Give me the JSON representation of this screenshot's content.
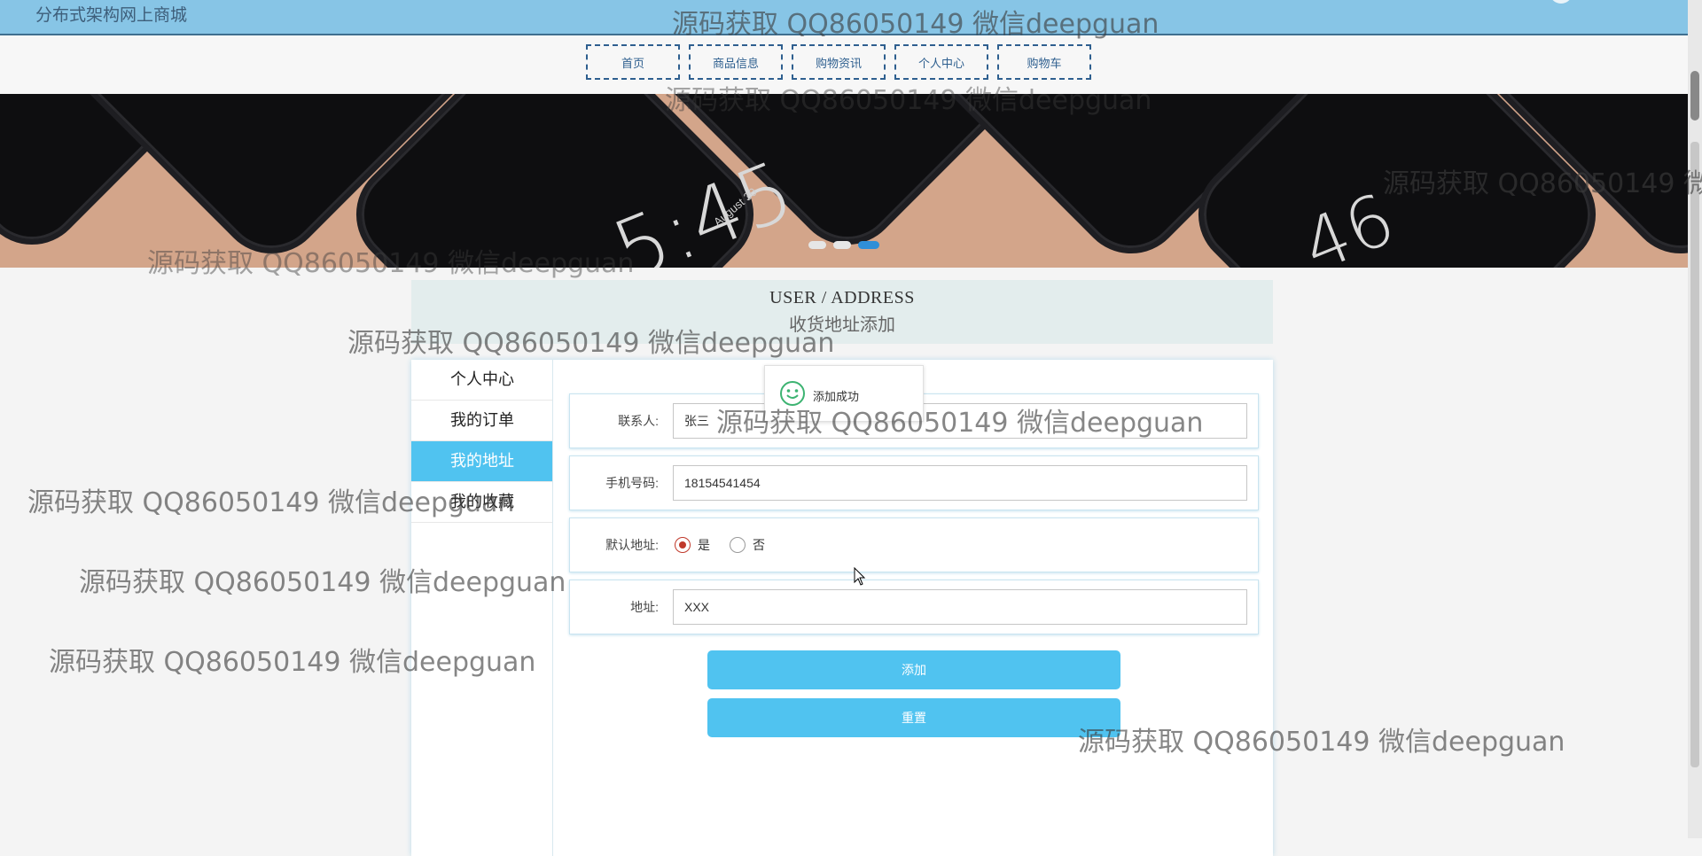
{
  "site": {
    "title": "分布式架构网上商城"
  },
  "nav": [
    {
      "label": "首页"
    },
    {
      "label": "商品信息"
    },
    {
      "label": "购物资讯"
    },
    {
      "label": "个人中心"
    },
    {
      "label": "购物车"
    }
  ],
  "banner": {
    "slide_count": 3,
    "active_slide": 3,
    "times": [
      "5:45",
      "46"
    ],
    "date_text": "August 30"
  },
  "page": {
    "title_en": "USER / ADDRESS",
    "title_cn": "收货地址添加"
  },
  "sidebar": {
    "items": [
      {
        "label": "个人中心",
        "active": false
      },
      {
        "label": "我的订单",
        "active": false
      },
      {
        "label": "我的地址",
        "active": true
      },
      {
        "label": "我的收藏",
        "active": false
      }
    ]
  },
  "form": {
    "contact": {
      "label": "联系人:",
      "value": "张三"
    },
    "phone": {
      "label": "手机号码:",
      "value": "18154541454"
    },
    "default": {
      "label": "默认地址:",
      "options": [
        "是",
        "否"
      ],
      "selected": "是"
    },
    "address": {
      "label": "地址:",
      "value": "XXX"
    },
    "submit_label": "添加",
    "reset_label": "重置"
  },
  "toast": {
    "text": "添加成功"
  },
  "watermark": {
    "text": "源码获取 QQ86050149 微信deepguan"
  },
  "colors": {
    "topbar": "#87c5e6",
    "accent": "#50c3f0",
    "nav_border": "#2e5f8f"
  }
}
